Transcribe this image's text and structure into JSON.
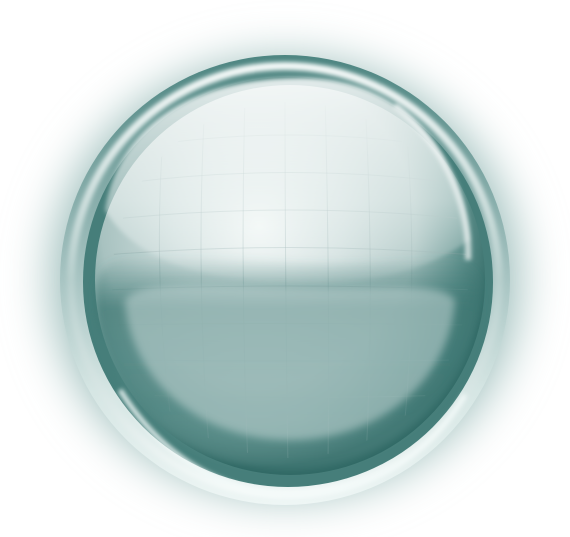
{
  "icon": {
    "name": "glass-orb-icon",
    "background_color": "#ffffff",
    "colors": {
      "glow": "#7fa7a4",
      "rim_dark": "#2f6a67",
      "rim_light": "#e9f3f2",
      "sphere_light": "#eef4f3",
      "sphere_mid": "#b9cfcd",
      "sphere_dark": "#3c7672",
      "grid": "#8aa7a5"
    }
  }
}
